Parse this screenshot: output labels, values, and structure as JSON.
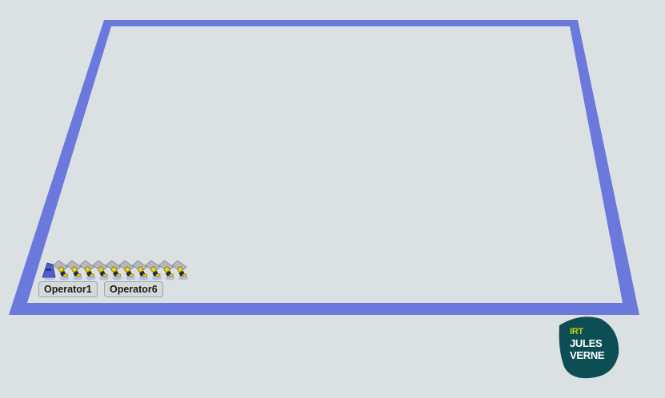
{
  "scene": {
    "zone_border_color": "#6b78dc",
    "background_color": "#dbe1e3",
    "operator_count": 11
  },
  "operators": {
    "label_1": "Operator1",
    "label_2": "Operator6"
  },
  "logo": {
    "line1": "IRT",
    "line2": "JULES",
    "line3": "VERNE",
    "bg_color": "#0d4e55",
    "accent_color": "#c8d400"
  }
}
